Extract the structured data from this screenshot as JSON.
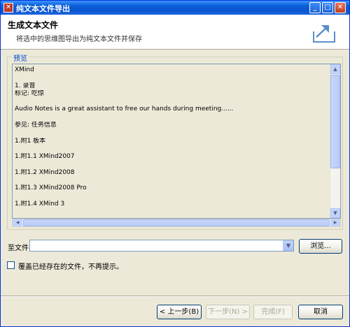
{
  "window": {
    "title": "纯文本文件导出"
  },
  "header": {
    "title": "生成文本文件",
    "description": "将选中的思维图导出为纯文本文件并保存"
  },
  "preview": {
    "legend": "预览",
    "lines": [
      "XMind",
      "",
      "1. 录音",
      "标记: 吃惊",
      "",
      "Audio Notes is a great assistant to free our hands during meeting......",
      "",
      "参见: 任务信息",
      "",
      "1.附1 板本",
      "",
      "1.附1.1 XMind2007",
      "",
      "1.附1.2 XMind2008",
      "",
      "1.附1.3 XMind2008 Pro",
      "",
      "1.附1.4 XMind 3"
    ]
  },
  "file": {
    "label": "至文件:",
    "value": "",
    "browse_label": "浏览..."
  },
  "overwrite": {
    "label": "覆盖已经存在的文件，不再提示。",
    "checked": false
  },
  "buttons": {
    "back": "< 上一步(B)",
    "next": "下一步(N) >",
    "finish": "完成(F)",
    "cancel": "取消"
  },
  "colors": {
    "titlebar": "#0a56d0",
    "window_bg": "#ece9d8",
    "legend": "#0046d5",
    "close_button": "#c33d1f"
  }
}
